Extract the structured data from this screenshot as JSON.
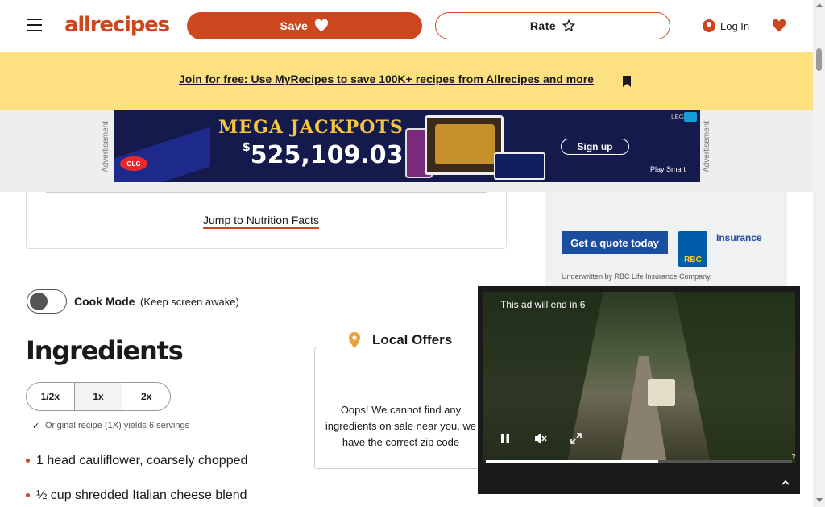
{
  "header": {
    "logo_text": "allrecipes",
    "save_label": "Save",
    "rate_label": "Rate",
    "login_label": "Log In"
  },
  "promo": {
    "link_text": "Join for free: Use MyRecipes to save 100K+ recipes from Allrecipes and more"
  },
  "ad_strip": {
    "ad_label": "Advertisement",
    "mega": {
      "title": "MEGA JACKPOTS",
      "amount": "525,109.03",
      "currency": "$",
      "signup": "Sign up",
      "play_smart": "Play Smart",
      "brand": "OLG",
      "legal": "LEGAL"
    }
  },
  "content": {
    "jump_link": "Jump to Nutrition Facts",
    "cook_mode_label": "Cook Mode",
    "keep_awake": "(Keep screen awake)",
    "ingredients_title": "Ingredients",
    "scale_options": [
      {
        "label": "1/2x",
        "active": false
      },
      {
        "label": "1x",
        "active": true
      },
      {
        "label": "2x",
        "active": false
      }
    ],
    "original_recipe_note": "Original recipe (1X) yields 6 servings",
    "ingredients": [
      "1 head cauliflower, coarsely chopped",
      "½ cup shredded Italian cheese blend"
    ]
  },
  "rbc_ad": {
    "cta": "Get a quote today",
    "brand": "RBC",
    "product": "Insurance",
    "underwriter": "Underwritten by RBC Life Insurance Company."
  },
  "local_offers": {
    "title": "Local Offers",
    "message": "Oops! We cannot find any ingredients on sale near you. we have the correct zip code"
  },
  "video_ad": {
    "countdown_text": "This ad will end in 6"
  },
  "colors": {
    "brand": "#ce4620",
    "promo_bg": "#fde180",
    "ad_strip_bg": "#eeeeee"
  },
  "icons": {
    "menu": "hamburger-icon",
    "heart": "heart-icon",
    "star": "star-icon",
    "user": "user-icon",
    "pin": "location-pin-icon",
    "pause": "pause-icon",
    "mute": "mute-icon",
    "expand": "expand-icon",
    "close": "close-icon"
  }
}
